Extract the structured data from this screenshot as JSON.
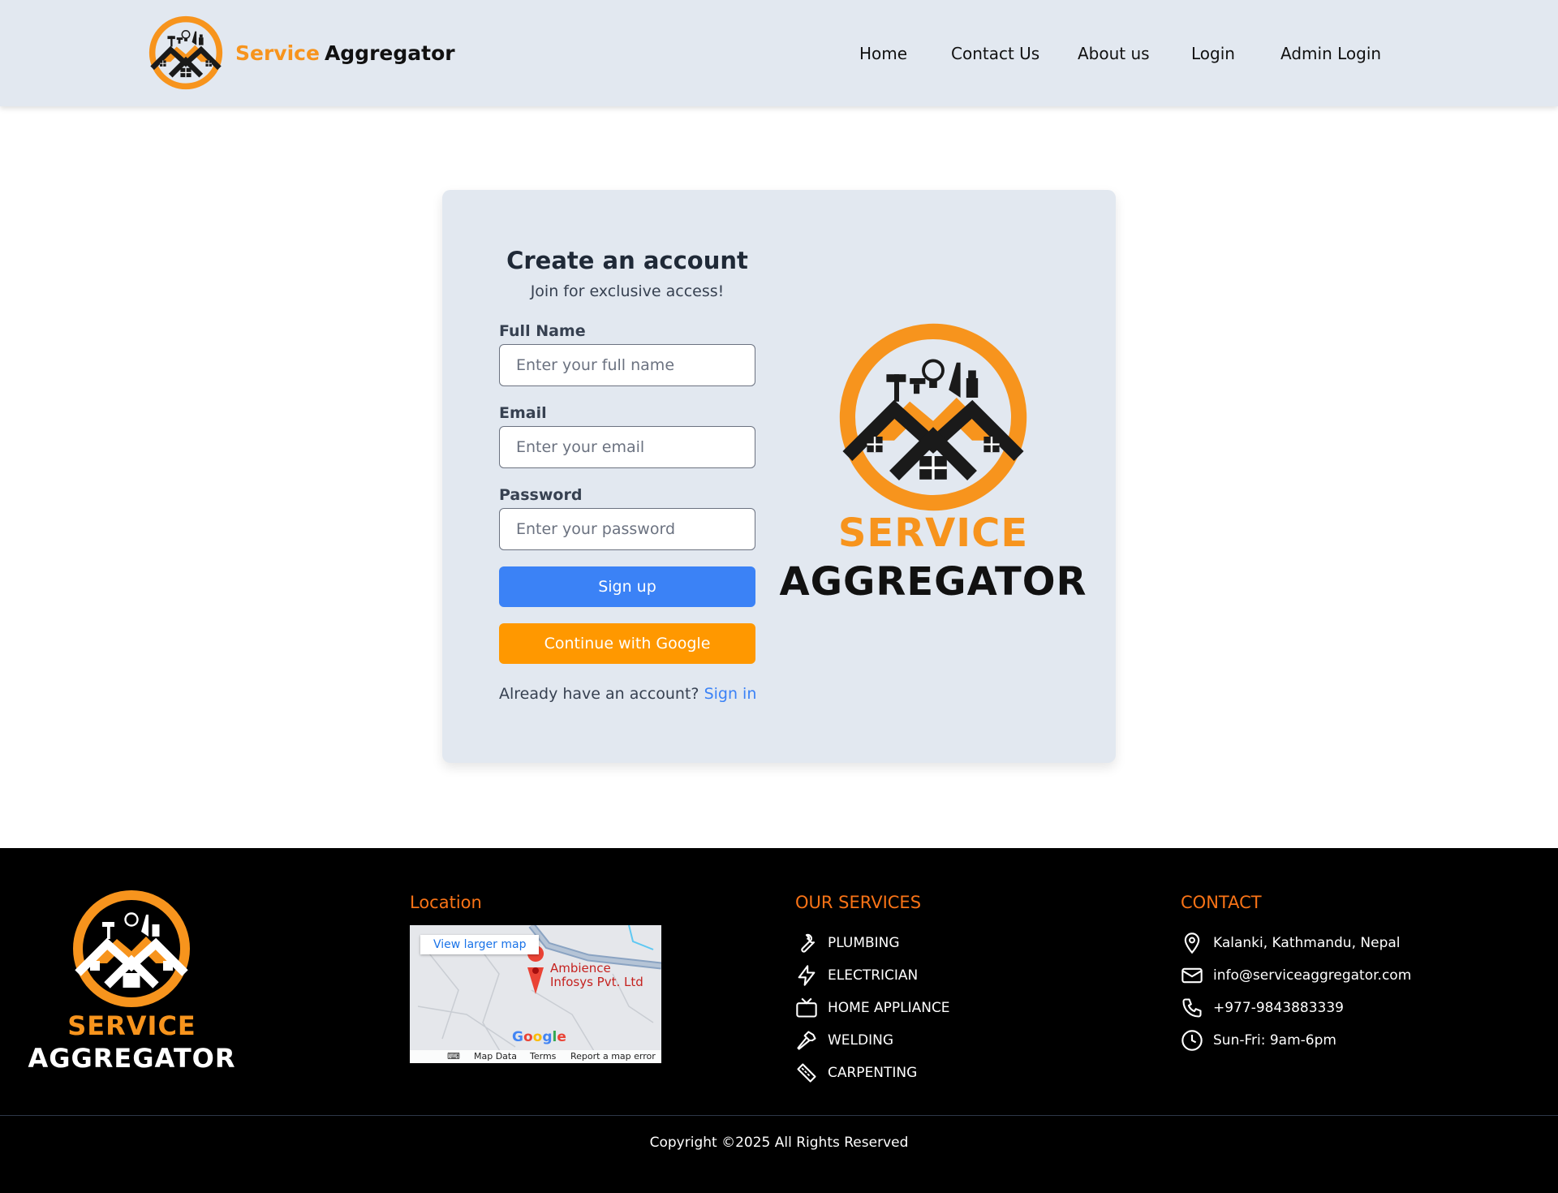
{
  "header": {
    "brand_part1": "Service",
    "brand_part2": "Aggregator",
    "nav": [
      "Home",
      "Contact Us",
      "About us",
      "Login",
      "Admin Login"
    ]
  },
  "form": {
    "title": "Create an account",
    "subtitle": "Join for exclusive access!",
    "fields": [
      {
        "label": "Full Name",
        "placeholder": "Enter your full name",
        "value": ""
      },
      {
        "label": "Email",
        "placeholder": "Enter your email",
        "value": ""
      },
      {
        "label": "Password",
        "placeholder": "Enter your password",
        "value": ""
      }
    ],
    "signup_label": "Sign up",
    "google_label": "Continue with Google",
    "already_text": "Already have an account?",
    "signin_label": "Sign in"
  },
  "card_logo": {
    "line1": "SERVICE",
    "line2": "AGGREGATOR"
  },
  "footer": {
    "logo_line1": "SERVICE",
    "logo_line2": "AGGREGATOR",
    "location_heading": "Location",
    "map": {
      "link": "View larger map",
      "place_line1": "Ambience",
      "place_line2": "Infosys Pvt. Ltd",
      "google": "Google",
      "map_data": "Map Data",
      "terms": "Terms",
      "report": "Report a map error"
    },
    "services_heading": "OUR SERVICES",
    "services": [
      {
        "icon": "wrench-icon",
        "label": "PLUMBING"
      },
      {
        "icon": "lightning-icon",
        "label": "ELECTRICIAN"
      },
      {
        "icon": "tv-icon",
        "label": "HOME APPLIANCE"
      },
      {
        "icon": "hammer-icon",
        "label": "WELDING"
      },
      {
        "icon": "ruler-icon",
        "label": "CARPENTING"
      }
    ],
    "contact_heading": "CONTACT",
    "contact": [
      {
        "icon": "location-pin-icon",
        "label": "Kalanki, Kathmandu, Nepal"
      },
      {
        "icon": "mail-icon",
        "label": "info@serviceaggregator.com"
      },
      {
        "icon": "phone-icon",
        "label": "+977-9843883339"
      },
      {
        "icon": "clock-icon",
        "label": "Sun-Fri: 9am-6pm"
      }
    ],
    "copyright": "Copyright ©2025 All Rights Reserved"
  },
  "colors": {
    "brand_orange": "#f7941d",
    "primary_blue": "#3b82f6",
    "google_orange": "#ff9800",
    "footer_heading": "#f97316",
    "panel_gray": "#e2e8f0"
  }
}
